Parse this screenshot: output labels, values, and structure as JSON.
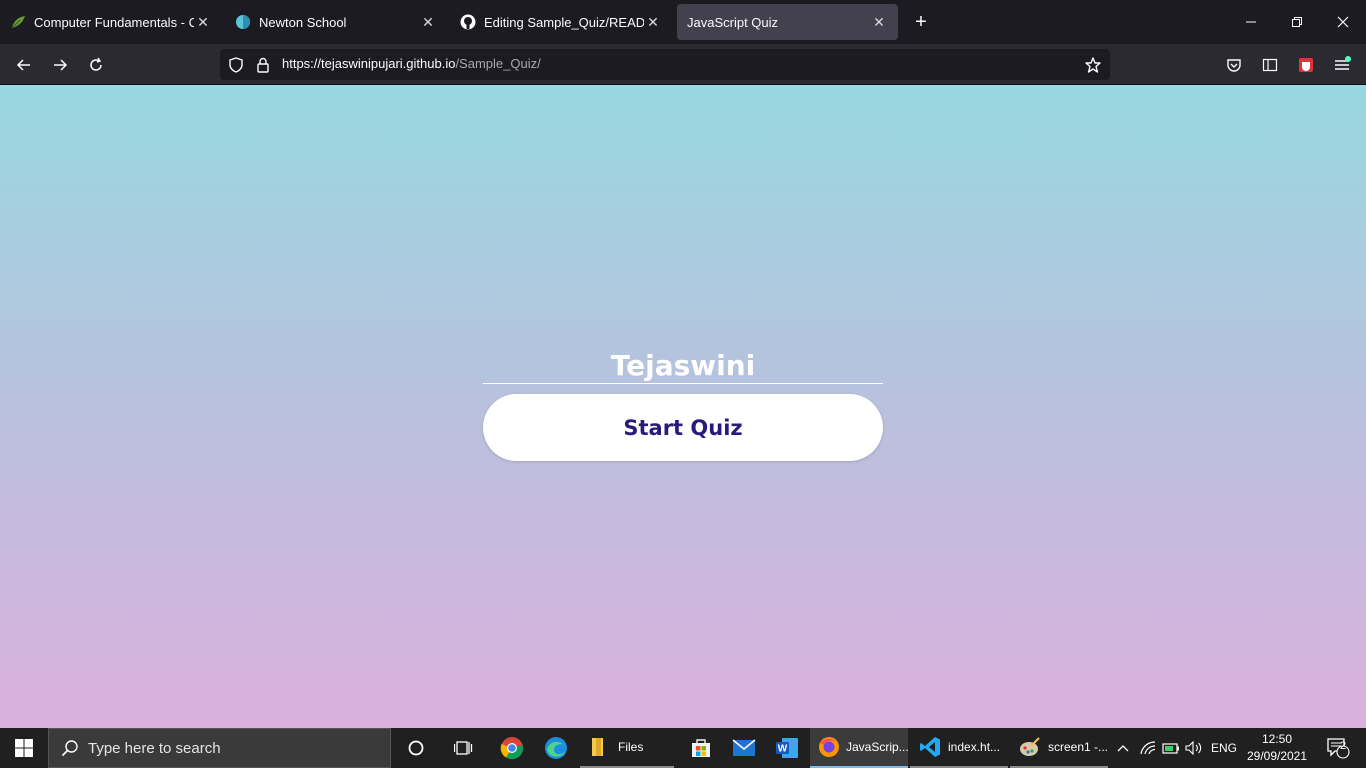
{
  "browser": {
    "tabs": [
      {
        "title": "Computer Fundamentals - Com",
        "icon": "leaf-icon",
        "active": false
      },
      {
        "title": "Newton School",
        "icon": "newton-logo-icon",
        "active": false
      },
      {
        "title": "Editing Sample_Quiz/README.m",
        "icon": "github-icon",
        "active": false
      },
      {
        "title": "JavaScript Quiz",
        "icon": "",
        "active": true
      }
    ],
    "url_host": "https://tejaswinipujari.github.io",
    "url_path": "/Sample_Quiz/"
  },
  "page": {
    "name_value": "Tejaswini",
    "start_button_label": "Start Quiz",
    "gradient_top": "#98d8e0",
    "gradient_bottom": "#dbb0dd",
    "button_text_color": "#2a1a7a"
  },
  "taskbar": {
    "search_placeholder": "Type here to search",
    "apps": [
      {
        "label": "Files",
        "icon": "folder-icon"
      },
      {
        "label": "JavaScrip...",
        "icon": "firefox-icon"
      },
      {
        "label": "index.ht...",
        "icon": "vscode-icon"
      },
      {
        "label": "screen1 -...",
        "icon": "paint-icon"
      }
    ],
    "language": "ENG",
    "time": "12:50",
    "date": "29/09/2021",
    "notification_count": "2"
  }
}
